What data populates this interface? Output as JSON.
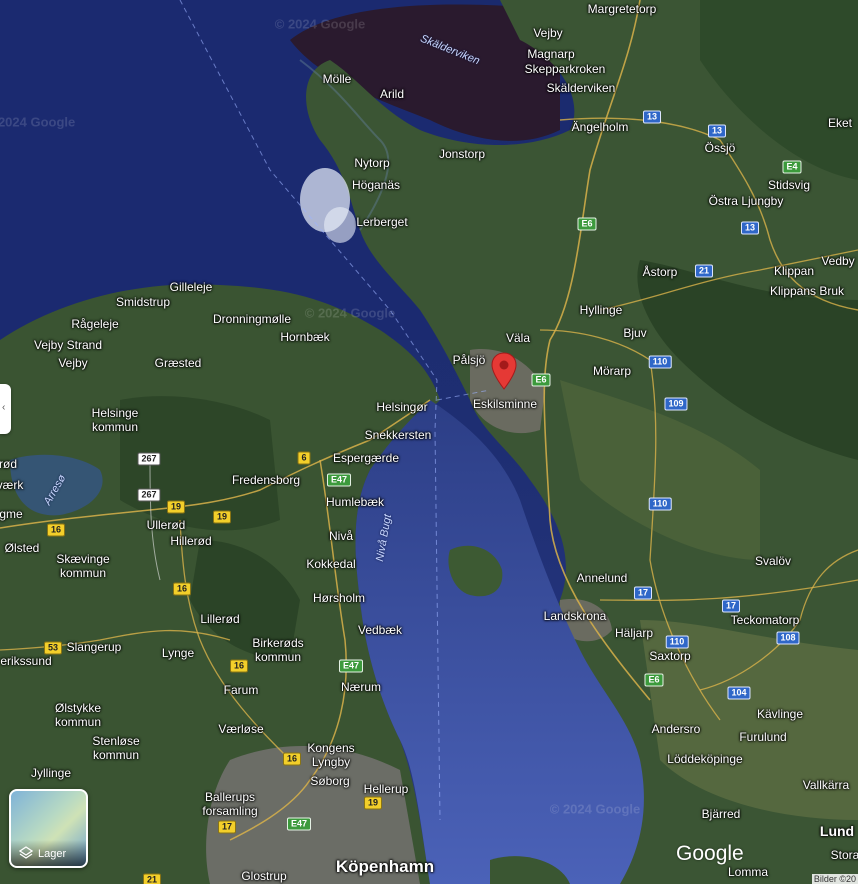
{
  "map": {
    "accent_water": "#1c2a66",
    "accent_land": "#2f4a2c",
    "pin_color": "#e53935",
    "marker": {
      "icon": "map-pin-icon"
    }
  },
  "labels": {
    "margretetorp": "Margretetorp",
    "vejby_se": "Vejby",
    "magnarp": "Magnarp",
    "skepparkroken": "Skepparkroken",
    "skalderviken": "Skälderviken",
    "skalderviken_water": "Skälderviken",
    "angelholm": "Ängelholm",
    "eket": "Eket",
    "ossjo": "Össjö",
    "molle": "Mölle",
    "arild": "Arild",
    "jonstorp": "Jonstorp",
    "nytorp": "Nytorp",
    "hoganas": "Höganäs",
    "stidsvig": "Stidsvig",
    "ostra_ljungby": "Östra Ljungby",
    "lerberget": "Lerberget",
    "vedby": "Vedby",
    "astorp": "Åstorp",
    "klippan": "Klippan",
    "klippans_bruk": "Klippans Bruk",
    "gilleleje": "Gilleleje",
    "smidstrup": "Smidstrup",
    "dronningmolle": "Dronningmølle",
    "rageleje": "Rågeleje",
    "hyllinge": "Hyllinge",
    "hornbaek": "Hornbæk",
    "vala": "Väla",
    "bjuv": "Bjuv",
    "vejby_strand": "Vejby Strand",
    "vejby_dk": "Vejby",
    "graested": "Græsted",
    "palsjo": "Pålsjö",
    "morarp": "Mörarp",
    "helsingor": "Helsingør",
    "eskilsminne": "Eskilsminne",
    "helsinge_kommun": "Helsinge\nkommun",
    "snekkersten": "Snekkersten",
    "espergaerde": "Espergærde",
    "fredensborg": "Fredensborg",
    "humlebaek": "Humlebæk",
    "arreso": "Arresø",
    "ollerod": "Ullerød",
    "hillerod": "Hillerød",
    "niva": "Nivå",
    "niva_bugt": "Nivå Bugt",
    "olsted": "Ølsted",
    "skaevinge_kommun": "Skævinge\nkommun",
    "kokkedal": "Kokkedal",
    "svalov": "Svalöv",
    "annelund": "Annelund",
    "horsholm": "Hørsholm",
    "landskrona": "Landskrona",
    "teckomatorp": "Teckomatorp",
    "lillerod": "Lillerød",
    "haljarp": "Häljarp",
    "vedbaek": "Vedbæk",
    "slangerup": "Slangerup",
    "lynge": "Lynge",
    "birkerods_kommun": "Birkerøds\nkommun",
    "saxtorp": "Saxtorp",
    "frederikssund": "erikssund",
    "farum": "Farum",
    "naerum": "Nærum",
    "kavlinge": "Kävlinge",
    "olstykke_kommun": "Ølstykke\nkommun",
    "furulund": "Furulund",
    "andersro": "Andersro",
    "vaerlose": "Værløse",
    "stenlose_kommun": "Stenløse\nkommun",
    "kongens_lyngby": "Kongens\nLyngby",
    "loddekopinge": "Löddeköpinge",
    "jyllinge": "Jyllinge",
    "soborg": "Søborg",
    "hellerup": "Hellerup",
    "vallkarra": "Vallkärra",
    "ballerups_forsamling": "Ballerups\nforsamling",
    "bjarred": "Bjärred",
    "lund": "Lund",
    "stora": "Stora",
    "kobenhavn": "Köpenhamn",
    "glostrup": "Glostrup",
    "lomma": "Lomma",
    "rod": "rød",
    "vaerk": "værk",
    "gme": "gme"
  },
  "shields": {
    "r13a": "13",
    "r13b": "13",
    "r13c": "13",
    "e4": "E4",
    "e6a": "E6",
    "e6b": "E6",
    "e6c": "E6",
    "r21": "21",
    "r110a": "110",
    "r110b": "110",
    "r110c": "110",
    "r109": "109",
    "r17a": "17",
    "r17b": "17",
    "r108": "108",
    "r104": "104",
    "d6": "6",
    "e47a": "E47",
    "e47b": "E47",
    "e47c": "E47",
    "d267a": "267",
    "d267b": "267",
    "d19a": "19",
    "d19b": "19",
    "d19c": "19",
    "d16a": "16",
    "d16b": "16",
    "d16c": "16",
    "d16d": "16",
    "d53": "53",
    "d17": "17",
    "d21": "21"
  },
  "watermarks": {
    "wm1": "© 2024 Google",
    "wm2": "© 2024 Google",
    "wm3": "© 2024 Google",
    "wm4": "© 2024 Google"
  },
  "controls": {
    "layers_label": "Lager",
    "google_logo": "Google",
    "attribution": "Bilder ©20",
    "side_tab_icon": "‹"
  }
}
